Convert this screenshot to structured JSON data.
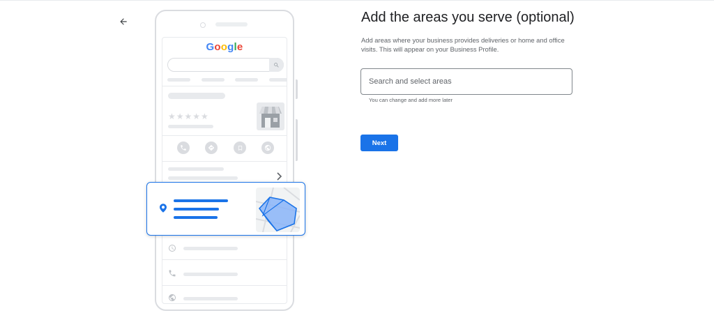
{
  "header": {
    "back_icon": "arrow-back-icon"
  },
  "illustration": {
    "logo": [
      "G",
      "o",
      "o",
      "g",
      "l",
      "e"
    ],
    "logo_colors": [
      "#4285f4",
      "#ea4335",
      "#fbbc05",
      "#4285f4",
      "#34a853",
      "#ea4335"
    ],
    "stars": "★★★★★",
    "icons": [
      "phone-icon",
      "directions-icon",
      "bookmark-icon",
      "globe-icon",
      "chevron-right-icon",
      "location-pin-icon",
      "clock-icon",
      "phone-icon",
      "globe-icon"
    ],
    "accent_color": "#1a73e8"
  },
  "main": {
    "title": "Add the areas you serve (optional)",
    "description": "Add areas where your business provides deliveries or home and office visits. This will appear on your Business Profile.",
    "search": {
      "placeholder": "Search and select areas",
      "value": "",
      "helper": "You can change and add more later"
    },
    "next_label": "Next"
  }
}
